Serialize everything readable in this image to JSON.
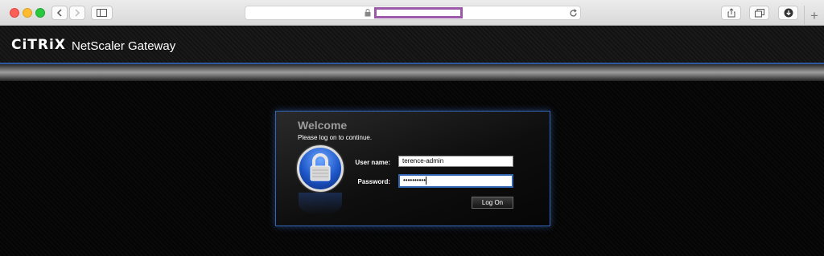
{
  "browser": {
    "back_icon": "chevron-left-icon",
    "forward_icon": "chevron-right-icon",
    "sidebar_icon": "sidebar-icon",
    "lock_icon": "lock-icon",
    "reload_icon": "reload-icon",
    "share_icon": "share-icon",
    "tabs_icon": "tabs-icon",
    "download_icon": "download-icon",
    "new_tab_label": "+"
  },
  "header": {
    "brand": "CiTRiX",
    "product": "NetScaler Gateway"
  },
  "login": {
    "title": "Welcome",
    "subtitle": "Please log on to continue.",
    "username_label": "User name:",
    "username_value": "terence-admin",
    "password_label": "Password:",
    "password_value": "••••••••••",
    "logon_label": "Log On"
  },
  "colors": {
    "accent": "#3467b3",
    "url_highlight": "#9a5aa8"
  }
}
